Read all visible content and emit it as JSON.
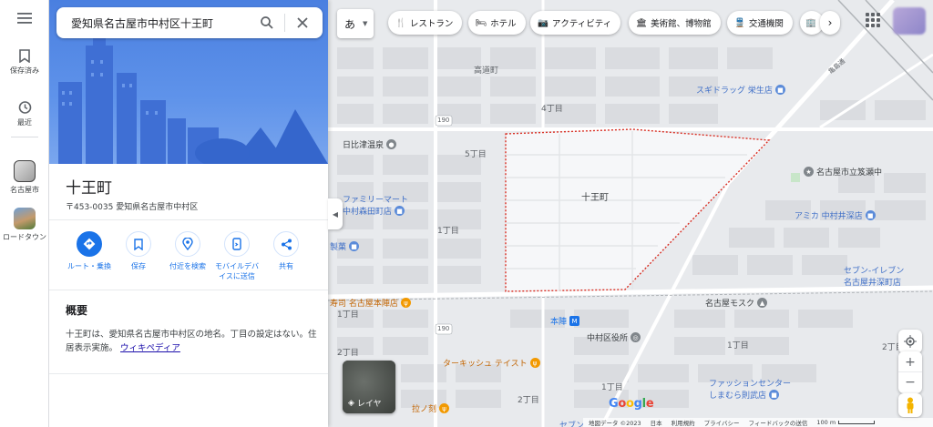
{
  "search": {
    "value": "愛知県名古屋市中村区十王町"
  },
  "rail": {
    "saved": "保存済み",
    "recent": "最近",
    "recent1": "名古屋市",
    "recent2": "ロードタウン"
  },
  "place": {
    "title": "十王町",
    "address": "〒453-0035 愛知県名古屋市中村区"
  },
  "actions": [
    {
      "label": "ルート・乗換"
    },
    {
      "label": "保存"
    },
    {
      "label": "付近を検索"
    },
    {
      "label_line1": "モバイルデバ",
      "label_line2": "イスに送信"
    },
    {
      "label": "共有"
    }
  ],
  "overview": {
    "heading": "概要",
    "text": "十王町は、愛知県名古屋市中村区の地名。丁目の設定はない。住居表示実施。",
    "link": "ウィキペディア"
  },
  "chips": {
    "lang": "あ",
    "items": [
      "レストラン",
      "ホテル",
      "アクティビティ",
      "美術館、博物館",
      "交通機関"
    ]
  },
  "map": {
    "area_label": "十王町",
    "labels": [
      "高道町",
      "4丁目",
      "5丁目",
      "1丁目",
      "1丁目",
      "2丁目",
      "1丁目",
      "2丁目",
      "1丁目",
      "2丁目",
      "190",
      "190",
      "亀島通"
    ],
    "pois": [
      {
        "name": "スギドラッグ 栄生店",
        "color": "#5b8bd9"
      },
      {
        "name": "日比津温泉",
        "color": "#80868b"
      },
      {
        "name": "名古屋市立笈瀬中",
        "color": "#80868b"
      },
      {
        "name_line1": "ファミリーマート",
        "name_line2": "中村森田町店",
        "color": "#5b8bd9"
      },
      {
        "name": "アミカ 中村井深店",
        "color": "#5b8bd9"
      },
      {
        "name": "製菓",
        "color": "#5b8bd9"
      },
      {
        "name_line1": "セブン-イレブン",
        "name_line2": "名古屋井深町店",
        "color": "#5b8bd9"
      },
      {
        "name": "寿司 名古屋本陣店",
        "color": "#f29900"
      },
      {
        "name": "名古屋モスク",
        "color": "#80868b"
      },
      {
        "name": "本陣",
        "color": "#1a73e8"
      },
      {
        "name": "中村区役所",
        "color": "#80868b"
      },
      {
        "name": "ターキッシュ テイスト",
        "color": "#f29900"
      },
      {
        "name_line1": "ファッションセンター",
        "name_line2": "しまむら則武店",
        "color": "#5b8bd9"
      },
      {
        "name": "拉ノ刻",
        "color": "#f29900"
      },
      {
        "name": "セブン",
        "color": "#5b8bd9"
      }
    ]
  },
  "layer_label": "レイヤ",
  "google": "Google",
  "footer": [
    "地図データ ©2023",
    "日本",
    "利用規約",
    "プライバシー",
    "フィードバックの送信",
    "100 m"
  ]
}
